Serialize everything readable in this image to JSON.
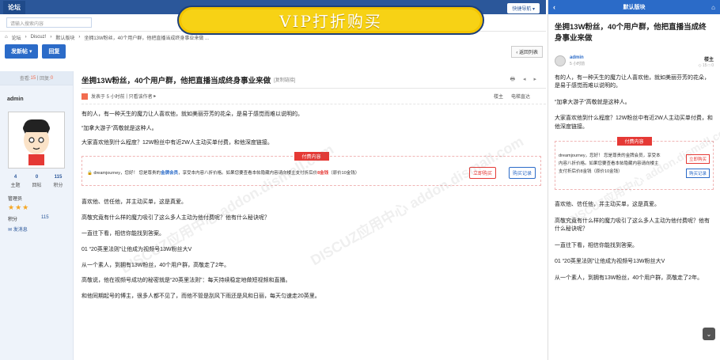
{
  "desktop": {
    "logo": "论坛",
    "quicknav": "快捷导航 ▾",
    "search_placeholder": "请输入搜索内容",
    "vip_banner": "VIP打折购买",
    "breadcrumb": [
      "论坛",
      "Discuz!",
      "默认版块",
      "坐拥13W粉丝，40个用户群，他把直播当成终身事业来做 ..."
    ],
    "new_post": "发新帖 ▾",
    "reply": "回复",
    "return_list": "‹ 返回列表",
    "stats": {
      "views_label": "查看:",
      "views": "15",
      "replies_label": "回复:",
      "replies": "0"
    },
    "author": "admin",
    "author_stats": [
      {
        "value": "4",
        "label": "主题"
      },
      {
        "value": "0",
        "label": "回帖"
      },
      {
        "value": "115",
        "label": "积分"
      }
    ],
    "role": "管理员",
    "stars": "★★★",
    "points_label": "积分",
    "points_value": "115",
    "send_msg": "发消息",
    "title": "坐拥13W粉丝，40个用户群，他把直播当成终身事业来做",
    "copy_link": "[复制链接]",
    "posted": "发表于 5 小时前",
    "only_author": "只看该作者",
    "floor": "楼主",
    "jump": "电梯直达",
    "paragraphs_before": [
      "有的人，有一种天生的魔力让人喜欢他，就如美丽芬芳的花朵，是易于感觉而难以说明的。",
      "“加拿大游子”高敬就是这种人。",
      "大家喜欢他到什么程度？12W粉丝中有近2W人主动买单付费，和他深度链接。"
    ],
    "paid": {
      "tag": "付费内容",
      "user": "dreamjourney",
      "text_a": "，您好！ 您是尊贵的",
      "vip": "金牌会员",
      "text_b": "，享受本内容八折价格。如果您要查看本帖隐藏内容请向楼主支付折后价",
      "price": "8金钱",
      "text_c": "（原价10金钱）",
      "buy": "立即购买",
      "record": "购买记录"
    },
    "paragraphs_after": [
      "喜欢他、信任他，并主动买单，这是真爱。",
      "高敬究竟有什么样的魔力吸引了这么多人主动为他付费呢？他有什么秘诀呢？",
      "一直往下看，相信你能找到答案。",
      "01 “20英里法则”让他成为视频号13W粉丝大V",
      "从一个素人，到拥有13W粉丝，40个用户群，高敬走了2年。",
      "高敬说，他在视频号成功的秘密就是“20英里法则”：每天持续稳定地做短视频和直播。",
      "和他同期起号的博主，很多人都不见了，而他不管是刮风下雨还是风和日丽，每天匀速走20英里。"
    ]
  },
  "mobile": {
    "header": "默认版块",
    "title": "坐拥13W粉丝，40个用户群，他把直播当成终身事业来做",
    "author": "admin",
    "time": "5 小时前",
    "floor": "楼主",
    "views_replies": "◇ 15 □ 0",
    "paragraphs_before": [
      "有的人，有一种天生的魔力让人喜欢他，就如美丽芬芳的花朵，是易于感觉而难以说明的。",
      "“加拿大游子”高敬就是这种人。",
      "大家喜欢他到什么程度？12W粉丝中有近2W人主动买单付费，和他深度链接。"
    ],
    "paid_tag": "付费内容",
    "paid_line1": "dreamjourney，您好！ 您是尊贵的金牌会员，享受本",
    "paid_line2": "内容八折价格。如果您要查看本帖隐藏内容请向楼主",
    "paid_line3": "支付折后价8金钱（原价10金钱）",
    "buy": "立即购买",
    "record": "购买记录",
    "paragraphs_after": [
      "喜欢他、信任他，并主动买单，这是真爱。",
      "高敬究竟有什么样的魔力吸引了这么多人主动为他付费呢？他有什么秘诀呢？",
      "一直往下看，相信你能找到答案。",
      "01 “20英里法则”让他成为视频号13W粉丝大V",
      "从一个素人，到拥有13W粉丝，40个用户群，高敬走了2年。"
    ]
  },
  "watermark": "DISCUZ应用中心 addon.dismall.com"
}
